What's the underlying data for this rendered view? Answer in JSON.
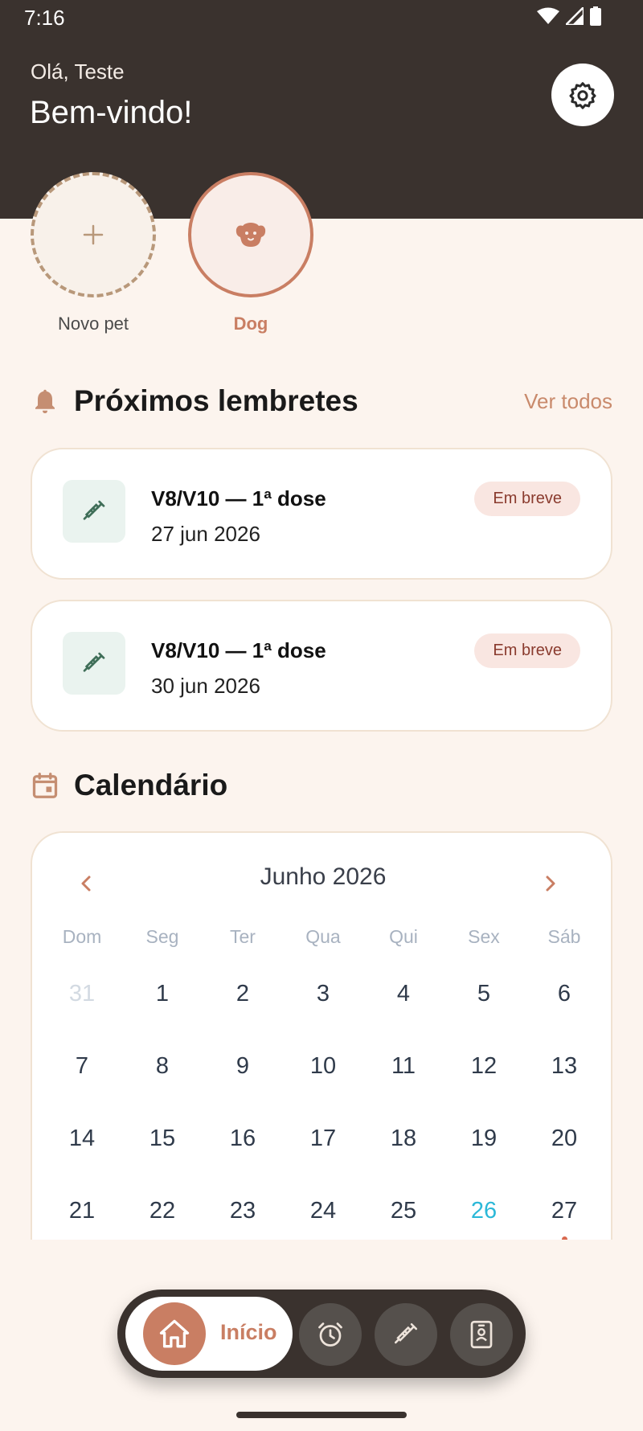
{
  "status_bar": {
    "time": "7:16"
  },
  "header": {
    "greeting": "Olá, Teste",
    "welcome": "Bem-vindo!",
    "settings_icon": "gear-icon"
  },
  "pets": {
    "new_pet_label": "Novo pet",
    "items": [
      {
        "name": "Dog",
        "icon": "dog-icon"
      }
    ]
  },
  "reminders": {
    "title": "Próximos lembretes",
    "see_all": "Ver todos",
    "items": [
      {
        "title": "V8/V10 — 1ª dose",
        "date": "27 jun 2026",
        "badge": "Em breve",
        "icon": "syringe-icon"
      },
      {
        "title": "V8/V10 — 1ª dose",
        "date": "30 jun 2026",
        "badge": "Em breve",
        "icon": "syringe-icon"
      }
    ]
  },
  "calendar": {
    "title": "Calendário",
    "month_label": "Junho 2026",
    "weekdays": [
      "Dom",
      "Seg",
      "Ter",
      "Qua",
      "Qui",
      "Sex",
      "Sáb"
    ],
    "days": [
      "31",
      "1",
      "2",
      "3",
      "4",
      "5",
      "6",
      "7",
      "8",
      "9",
      "10",
      "11",
      "12",
      "13",
      "14",
      "15",
      "16",
      "17",
      "18",
      "19",
      "20",
      "21",
      "22",
      "23",
      "24",
      "25",
      "26",
      "27"
    ],
    "outside_month_days": [
      "31"
    ],
    "today": "26",
    "event_days": [
      "27"
    ]
  },
  "bottom_nav": {
    "home_label": "Início",
    "items": [
      "home-icon",
      "alarm-icon",
      "syringe-icon",
      "id-card-icon"
    ]
  },
  "colors": {
    "header_bg": "#3A322E",
    "page_bg": "#FCF4EE",
    "accent": "#C97E63",
    "today": "#2BB8D8",
    "badge_bg": "#F9E6E1"
  }
}
